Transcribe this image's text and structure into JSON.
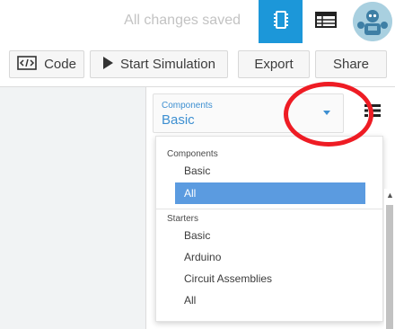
{
  "header": {
    "save_status": "All changes saved",
    "circuit_view_icon": "breadboard-icon",
    "components_list_icon": "table-icon",
    "avatar_icon": "user-avatar-icon",
    "accent_color": "#1c97d9"
  },
  "toolbar": {
    "code_label": "Code",
    "code_icon": "code-icon",
    "start_simulation_label": "Start Simulation",
    "start_simulation_icon": "play-icon",
    "export_label": "Export",
    "share_label": "Share"
  },
  "components_select": {
    "caption": "Components",
    "value": "Basic",
    "arrow_icon": "caret-down-icon",
    "color": "#3d8fd1"
  },
  "list_view_icon": "list-view-icon",
  "dropdown": {
    "groups": [
      {
        "label": "Components",
        "options": [
          {
            "label": "Basic",
            "selected": false
          },
          {
            "label": "All",
            "selected": true
          }
        ]
      },
      {
        "label": "Starters",
        "options": [
          {
            "label": "Basic",
            "selected": false
          },
          {
            "label": "Arduino",
            "selected": false
          },
          {
            "label": "Circuit Assemblies",
            "selected": false
          },
          {
            "label": "All",
            "selected": false
          }
        ]
      }
    ],
    "selected_color": "#5b9be0"
  },
  "annotation": {
    "shape": "circle",
    "color": "#ee1c24"
  }
}
